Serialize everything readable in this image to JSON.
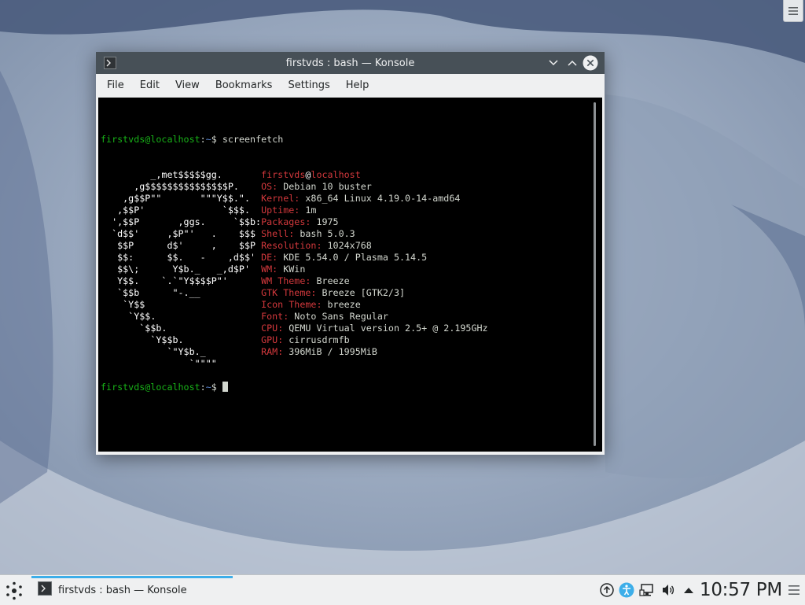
{
  "window": {
    "title": "firstvds : bash — Konsole",
    "menu": [
      "File",
      "Edit",
      "View",
      "Bookmarks",
      "Settings",
      "Help"
    ]
  },
  "terminal": {
    "prompt_user": "firstvds@localhost",
    "prompt_sep": ":",
    "prompt_path": "~",
    "prompt_symbol": "$",
    "command": "screenfetch",
    "info_user": "firstvds",
    "info_at": "@",
    "info_host": "localhost",
    "logo_lines": [
      "         _,met$$$$$gg.",
      "      ,g$$$$$$$$$$$$$$$P.",
      "    ,g$$P\"\"       \"\"\"Y$$.\".",
      "   ,$$P'              `$$$.",
      "  ',$$P       ,ggs.     `$$b:",
      "  `d$$'     ,$P\"'   .    $$$",
      "   $$P      d$'     ,    $$P",
      "   $$:      $$.   -    ,d$$'",
      "   $$\\;      Y$b._   _,d$P'",
      "   Y$$.    `.`\"Y$$$$P\"'",
      "   `$$b      \"-.__",
      "    `Y$$",
      "     `Y$$.",
      "       `$$b.",
      "         `Y$$b.",
      "            `\"Y$b._",
      "                `\"\"\"\""
    ],
    "info": [
      {
        "key": "OS",
        "value": "Debian 10 buster"
      },
      {
        "key": "Kernel",
        "value": "x86_64 Linux 4.19.0-14-amd64"
      },
      {
        "key": "Uptime",
        "value": "1m"
      },
      {
        "key": "Packages",
        "value": "1975"
      },
      {
        "key": "Shell",
        "value": "bash 5.0.3"
      },
      {
        "key": "Resolution",
        "value": "1024x768"
      },
      {
        "key": "DE",
        "value": "KDE 5.54.0 / Plasma 5.14.5"
      },
      {
        "key": "WM",
        "value": "KWin"
      },
      {
        "key": "WM Theme",
        "value": "Breeze"
      },
      {
        "key": "GTK Theme",
        "value": "Breeze [GTK2/3]"
      },
      {
        "key": "Icon Theme",
        "value": "breeze"
      },
      {
        "key": "Font",
        "value": "Noto Sans Regular"
      },
      {
        "key": "CPU",
        "value": "QEMU Virtual version 2.5+ @ 2.195GHz"
      },
      {
        "key": "GPU",
        "value": "cirrusdrmfb"
      },
      {
        "key": "RAM",
        "value": "396MiB / 1995MiB"
      }
    ]
  },
  "taskbar": {
    "task_label": "firstvds : bash — Konsole",
    "clock": "10:57 PM"
  },
  "colors": {
    "accent": "#3daee9",
    "prompt_green": "#18b218",
    "path_blue": "#5c8ad6",
    "info_red": "#d2383c"
  },
  "icons": {
    "launcher": "kde-launcher-icon",
    "terminal": "konsole-icon",
    "tray": [
      "update-icon",
      "accessibility-icon",
      "network-icon",
      "volume-icon",
      "expand-tray-icon"
    ],
    "show_desktop": "show-desktop-icon"
  }
}
